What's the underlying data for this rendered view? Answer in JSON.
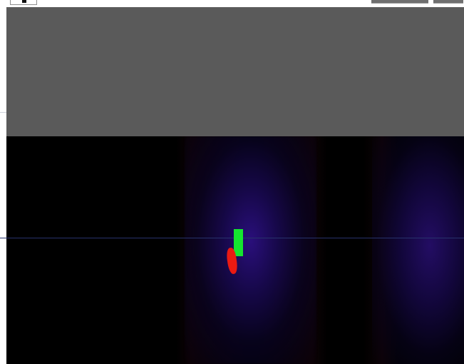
{
  "window": {
    "top_controls": [
      {
        "name": "top-left-control",
        "icon": "small-toggle-icon"
      },
      {
        "name": "top-right-control-1",
        "icon": "tab-strip-icon"
      },
      {
        "name": "top-right-control-2",
        "icon": "tab-strip-icon"
      }
    ]
  },
  "viewer": {
    "panels": [
      {
        "name": "gray-panel",
        "color": "#5a5a5a"
      },
      {
        "name": "dark-view",
        "color": "#000000"
      }
    ],
    "regions": [
      {
        "name": "center-blue-haze",
        "color": "#2c1082"
      },
      {
        "name": "right-blue-haze",
        "color": "#260e6c"
      }
    ],
    "markers": [
      {
        "name": "green-marker",
        "color": "#15e62f"
      },
      {
        "name": "red-marker",
        "color": "#ea1a12"
      }
    ]
  }
}
